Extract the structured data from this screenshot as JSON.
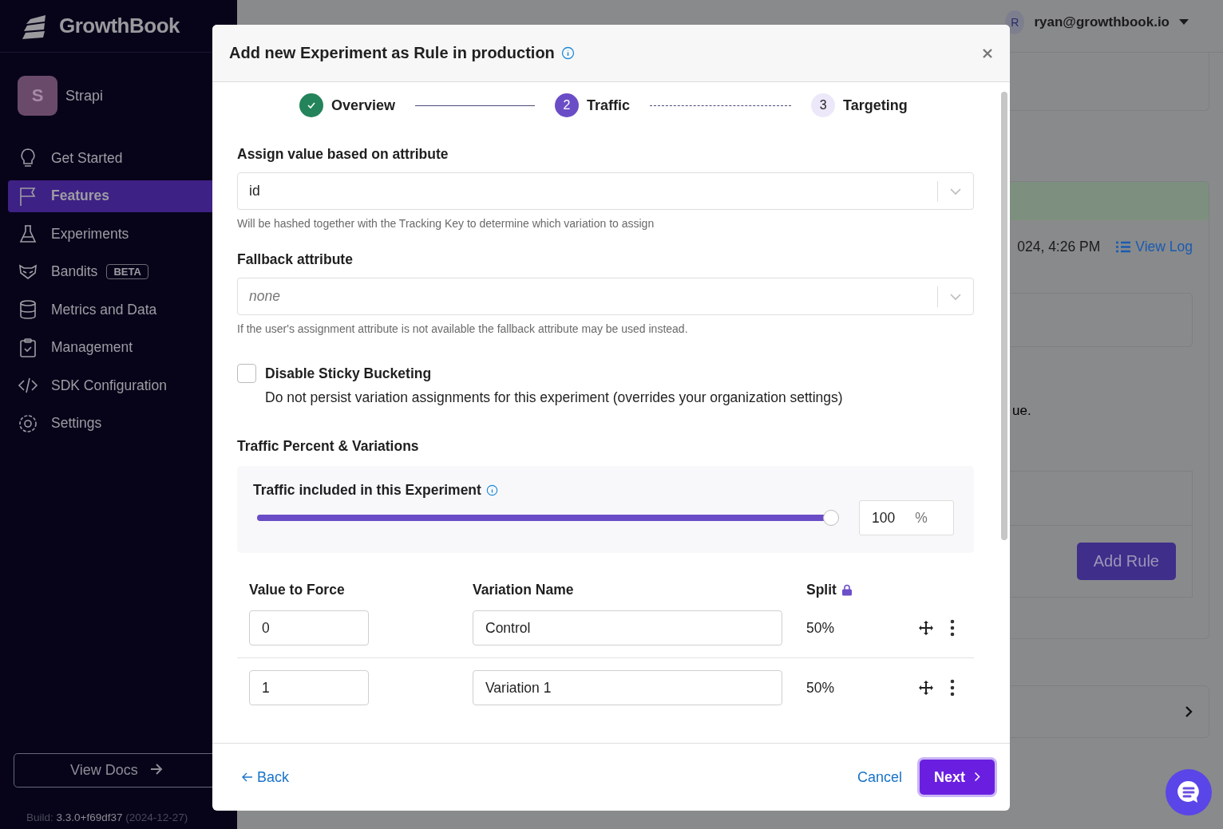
{
  "sidebar": {
    "brand": "GrowthBook",
    "org": {
      "initial": "S",
      "name": "Strapi"
    },
    "items": [
      {
        "label": "Get Started",
        "kind": "bulb",
        "selected": false
      },
      {
        "label": "Features",
        "kind": "flag",
        "selected": true
      },
      {
        "label": "Experiments",
        "kind": "flask",
        "selected": false
      },
      {
        "label": "Bandits",
        "kind": "raccoon",
        "selected": false,
        "badge": "BETA"
      },
      {
        "label": "Metrics and Data",
        "kind": "database",
        "selected": false
      },
      {
        "label": "Management",
        "kind": "clipboard",
        "selected": false
      },
      {
        "label": "SDK Configuration",
        "kind": "code",
        "selected": false
      },
      {
        "label": "Settings",
        "kind": "gear",
        "selected": false
      }
    ],
    "docs_button": "View Docs",
    "build": {
      "label": "Build:",
      "version": "3.3.0+f69df37",
      "date": "(2024-12-27)"
    }
  },
  "header": {
    "avatar": "R",
    "user": "ryan@growthbook.io"
  },
  "background": {
    "timestamp": "024, 4:26 PM",
    "view_log": "View Log",
    "note": "ue.",
    "add_rule": "Add Rule"
  },
  "modal": {
    "title": "Add new Experiment as Rule in production",
    "steps": [
      {
        "label": "Overview",
        "kind": "done"
      },
      {
        "number": "2",
        "label": "Traffic",
        "kind": "active"
      },
      {
        "number": "3",
        "label": "Targeting",
        "kind": "pending"
      }
    ],
    "assign": {
      "label": "Assign value based on attribute",
      "value": "id",
      "help": "Will be hashed together with the Tracking Key to determine which variation to assign"
    },
    "fallback": {
      "label": "Fallback attribute",
      "placeholder": "none",
      "help": "If the user's assignment attribute is not available the fallback attribute may be used instead."
    },
    "sticky": {
      "label": "Disable Sticky Bucketing",
      "description": "Do not persist variation assignments for this experiment (overrides your organization settings)",
      "checked": false
    },
    "section_title": "Traffic Percent & Variations",
    "traffic": {
      "label": "Traffic included in this Experiment",
      "level": 1,
      "value": "100",
      "unit": "%"
    },
    "columns": [
      "Value to Force",
      "Variation Name",
      "Split"
    ],
    "variations": [
      {
        "value": "0",
        "name": "Control",
        "split": "50%"
      },
      {
        "value": "1",
        "name": "Variation 1",
        "split": "50%"
      }
    ],
    "back": "Back",
    "cancel": "Cancel",
    "next": "Next"
  }
}
